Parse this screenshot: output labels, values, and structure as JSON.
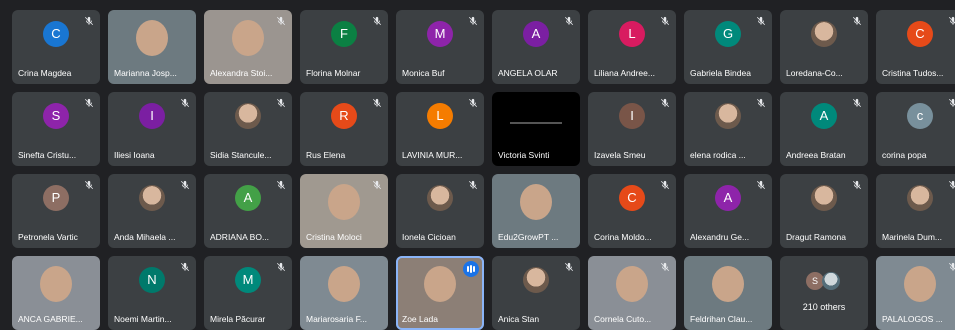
{
  "meeting": {
    "participants": [
      {
        "name": "Crina Magdea",
        "initial": "C",
        "color": "#1976d2",
        "kind": "initial",
        "muted": true
      },
      {
        "name": "Marianna Josp...",
        "initial": "",
        "color": "",
        "kind": "video",
        "muted": false
      },
      {
        "name": "Alexandra Stoi...",
        "initial": "",
        "color": "",
        "kind": "video",
        "muted": true
      },
      {
        "name": "Florina Molnar",
        "initial": "F",
        "color": "#0b8043",
        "kind": "initial",
        "muted": true
      },
      {
        "name": "Monica Buf",
        "initial": "M",
        "color": "#8e24aa",
        "kind": "initial",
        "muted": true
      },
      {
        "name": "ANGELA OLAR",
        "initial": "A",
        "color": "#7b1fa2",
        "kind": "initial",
        "muted": true
      },
      {
        "name": "Liliana Andree...",
        "initial": "L",
        "color": "#d81b60",
        "kind": "initial",
        "muted": true
      },
      {
        "name": "Gabriela Bindea",
        "initial": "G",
        "color": "#00897b",
        "kind": "initial",
        "muted": true
      },
      {
        "name": "Loredana-Co...",
        "initial": "",
        "color": "",
        "kind": "photo",
        "muted": true
      },
      {
        "name": "Cristina Tudos...",
        "initial": "C",
        "color": "#e64a19",
        "kind": "initial",
        "muted": true
      },
      {
        "name": "Sinefta Cristu...",
        "initial": "S",
        "color": "#8e24aa",
        "kind": "initial",
        "muted": true
      },
      {
        "name": "Iliesi Ioana",
        "initial": "I",
        "color": "#7b1fa2",
        "kind": "initial",
        "muted": true
      },
      {
        "name": "Sidia Stancule...",
        "initial": "",
        "color": "",
        "kind": "photo",
        "muted": true
      },
      {
        "name": "Rus Elena",
        "initial": "R",
        "color": "#e64a19",
        "kind": "initial",
        "muted": true
      },
      {
        "name": "LAVINIA MUR...",
        "initial": "L",
        "color": "#f57c00",
        "kind": "initial",
        "muted": true
      },
      {
        "name": "Victoria Svinti",
        "initial": "",
        "color": "",
        "kind": "dark",
        "muted": false
      },
      {
        "name": "Izavela Smeu",
        "initial": "I",
        "color": "#795548",
        "kind": "initial",
        "muted": true
      },
      {
        "name": "elena rodica ...",
        "initial": "",
        "color": "",
        "kind": "photo",
        "muted": true
      },
      {
        "name": "Andreea Bratan",
        "initial": "A",
        "color": "#00897b",
        "kind": "initial",
        "muted": true
      },
      {
        "name": "corina popa",
        "initial": "c",
        "color": "#78909c",
        "kind": "initial",
        "muted": true
      },
      {
        "name": "Petronela Vartic",
        "initial": "P",
        "color": "#8d6e63",
        "kind": "initial",
        "muted": true
      },
      {
        "name": "Anda Mihaela ...",
        "initial": "",
        "color": "",
        "kind": "photo",
        "muted": true
      },
      {
        "name": "ADRIANA BO...",
        "initial": "A",
        "color": "#43a047",
        "kind": "initial",
        "muted": true
      },
      {
        "name": "Cristina Moloci",
        "initial": "",
        "color": "",
        "kind": "video",
        "muted": true
      },
      {
        "name": "Ionela Cicioan",
        "initial": "",
        "color": "",
        "kind": "photo",
        "muted": true
      },
      {
        "name": "Edu2GrowPT ...",
        "initial": "",
        "color": "",
        "kind": "video",
        "muted": false
      },
      {
        "name": "Corina Moldo...",
        "initial": "C",
        "color": "#e64a19",
        "kind": "initial",
        "muted": true
      },
      {
        "name": "Alexandru Ge...",
        "initial": "A",
        "color": "#8e24aa",
        "kind": "initial",
        "muted": true
      },
      {
        "name": "Dragut Ramona",
        "initial": "",
        "color": "",
        "kind": "photo",
        "muted": true
      },
      {
        "name": "Marinela Dum...",
        "initial": "",
        "color": "",
        "kind": "photo",
        "muted": true
      },
      {
        "name": "ANCA GABRIE...",
        "initial": "",
        "color": "",
        "kind": "video",
        "muted": false
      },
      {
        "name": "Noemi Martin...",
        "initial": "N",
        "color": "#00796b",
        "kind": "initial",
        "muted": true
      },
      {
        "name": "Mirela Păcurar",
        "initial": "M",
        "color": "#00897b",
        "kind": "initial",
        "muted": true
      },
      {
        "name": "Mariarosaria F...",
        "initial": "",
        "color": "",
        "kind": "video",
        "muted": false
      },
      {
        "name": "Zoe Lada",
        "initial": "",
        "color": "",
        "kind": "video",
        "muted": false,
        "speaking": true
      },
      {
        "name": "Anica Stan",
        "initial": "",
        "color": "",
        "kind": "photo",
        "muted": true
      },
      {
        "name": "Cornela Cuto...",
        "initial": "",
        "color": "",
        "kind": "video",
        "muted": true
      },
      {
        "name": "Feldrihan Clau...",
        "initial": "",
        "color": "",
        "kind": "video",
        "muted": false
      },
      {
        "name": "210 others",
        "initial": "S",
        "color": "#8d6e63",
        "kind": "others",
        "muted": false
      },
      {
        "name": "PALALOGOS ...",
        "initial": "",
        "color": "",
        "kind": "video",
        "muted": true
      }
    ]
  }
}
